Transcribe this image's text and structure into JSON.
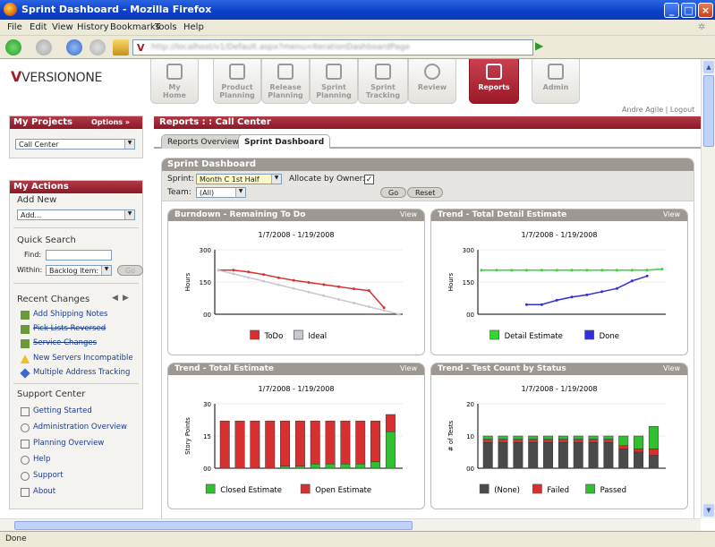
{
  "window": {
    "title": "Sprint Dashboard - Mozilla Firefox"
  },
  "menu": [
    "File",
    "Edit",
    "View",
    "History",
    "Bookmarks",
    "Tools",
    "Help"
  ],
  "browser": {
    "url": "http://localhost/v1/Default.aspx?menu=IterationDashboardPage",
    "status": "Done"
  },
  "app": {
    "logo": {
      "mark": "V",
      "name": "VERSIONONE"
    },
    "tabs": [
      {
        "label1": "My",
        "label2": "Home"
      },
      {
        "label1": "Product",
        "label2": "Planning"
      },
      {
        "label1": "Release",
        "label2": "Planning"
      },
      {
        "label1": "Sprint",
        "label2": "Planning"
      },
      {
        "label1": "Sprint",
        "label2": "Tracking"
      },
      {
        "label1": "Review",
        "label2": ""
      },
      {
        "label1": "Reports",
        "label2": ""
      },
      {
        "label1": "Admin",
        "label2": ""
      }
    ],
    "user": "Andre Agile",
    "logout": "Logout"
  },
  "sidebar": {
    "projects_title": "My Projects",
    "options": "Options »",
    "project": "Call Center",
    "actions_title": "My Actions",
    "add_new": "Add New",
    "add_select": "Add...",
    "quick_search": "Quick Search",
    "find_label": "Find:",
    "within_label": "Within:",
    "within_value": "Backlog Item:",
    "go": "Go",
    "recent_changes": "Recent Changes",
    "recent": [
      {
        "label": "Add Shipping Notes",
        "icon": "story-icon"
      },
      {
        "label": "Pick Lists Reversed",
        "icon": "story-icon",
        "struck": true
      },
      {
        "label": "Service Changes",
        "icon": "story-icon",
        "struck": true
      },
      {
        "label": "New Servers Incompatible",
        "icon": "warning-icon"
      },
      {
        "label": "Multiple Address Tracking",
        "icon": "diamond-icon"
      }
    ],
    "support_center": "Support Center",
    "support": [
      {
        "label": "Getting Started",
        "icon": "home-icon"
      },
      {
        "label": "Administration Overview",
        "icon": "wrench-icon"
      },
      {
        "label": "Planning Overview",
        "icon": "planning-icon"
      },
      {
        "label": "Help",
        "icon": "help-icon"
      },
      {
        "label": "Support",
        "icon": "support-icon"
      },
      {
        "label": "About",
        "icon": "about-icon"
      }
    ]
  },
  "main": {
    "breadcrumb": "Reports : : Call Center",
    "tabs": [
      "Reports Overview",
      "Sprint Dashboard"
    ],
    "dashboard_title": "Sprint Dashboard",
    "filters": {
      "sprint_label": "Sprint:",
      "sprint_value": "Month C 1st Half",
      "allocate_label": "Allocate by Owner:",
      "allocate_checked": "✓",
      "team_label": "Team:",
      "team_value": "(All)",
      "go": "Go",
      "reset": "Reset"
    },
    "view_label": "View"
  },
  "chart_data": [
    {
      "type": "line",
      "title": "Burndown - Remaining To Do",
      "subtitle": "1/7/2008 - 1/19/2008",
      "ylabel": "Hours",
      "ylim": [
        0,
        300
      ],
      "yticks": [
        "300",
        "150",
        "00"
      ],
      "x": [
        1,
        2,
        3,
        4,
        5,
        6,
        7,
        8,
        9,
        10,
        11,
        12,
        13
      ],
      "series": [
        {
          "name": "ToDo",
          "color": "#d83030",
          "values": [
            205,
            205,
            197,
            185,
            170,
            158,
            148,
            138,
            128,
            118,
            110,
            30,
            null
          ]
        },
        {
          "name": "Ideal",
          "color": "#c8c8d0",
          "values": [
            205,
            188,
            171,
            154,
            137,
            120,
            103,
            86,
            69,
            52,
            35,
            18,
            0
          ]
        }
      ]
    },
    {
      "type": "line",
      "title": "Trend - Total Detail Estimate",
      "subtitle": "1/7/2008 - 1/19/2008",
      "ylabel": "Hours",
      "ylim": [
        0,
        300
      ],
      "yticks": [
        "300",
        "150",
        "00"
      ],
      "x": [
        1,
        2,
        3,
        4,
        5,
        6,
        7,
        8,
        9,
        10,
        11,
        12,
        13
      ],
      "series": [
        {
          "name": "Detail Estimate",
          "color": "#30d830",
          "values": [
            205,
            205,
            205,
            205,
            205,
            205,
            205,
            205,
            205,
            205,
            205,
            205,
            210
          ]
        },
        {
          "name": "Done",
          "color": "#3030d8",
          "values": [
            null,
            null,
            null,
            45,
            45,
            65,
            80,
            90,
            105,
            120,
            155,
            178,
            null
          ]
        }
      ]
    },
    {
      "type": "bar",
      "title": "Trend - Total Estimate",
      "subtitle": "1/7/2008 - 1/19/2008",
      "ylabel": "Story Points",
      "ylim": [
        0,
        30
      ],
      "yticks": [
        "30",
        "15",
        "00"
      ],
      "categories": [
        "1",
        "2",
        "3",
        "4",
        "5",
        "6",
        "7",
        "8",
        "9",
        "10",
        "11",
        "12"
      ],
      "series": [
        {
          "name": "Closed Estimate",
          "color": "#30c030",
          "values": [
            0,
            0,
            0,
            0,
            1,
            1,
            2,
            2,
            2,
            2,
            3,
            17
          ]
        },
        {
          "name": "Open Estimate",
          "color": "#d83030",
          "values": [
            22,
            22,
            22,
            22,
            21,
            21,
            20,
            20,
            20,
            20,
            19,
            8
          ]
        }
      ]
    },
    {
      "type": "bar",
      "title": "Trend - Test Count by Status",
      "subtitle": "1/7/2008 - 1/19/2008",
      "ylabel": "# of Tests",
      "ylim": [
        0,
        20
      ],
      "yticks": [
        "20",
        "10",
        "00"
      ],
      "categories": [
        "1",
        "2",
        "3",
        "4",
        "5",
        "6",
        "7",
        "8",
        "9",
        "10",
        "11",
        "12"
      ],
      "series": [
        {
          "name": "(None)",
          "color": "#4a4a4a",
          "values": [
            8,
            8,
            8,
            8,
            8,
            8,
            8,
            8,
            8,
            6,
            5,
            4
          ]
        },
        {
          "name": "Failed",
          "color": "#d83030",
          "values": [
            1,
            1,
            1,
            1,
            1,
            1,
            1,
            1,
            1,
            1,
            1,
            2
          ]
        },
        {
          "name": "Passed",
          "color": "#30c030",
          "values": [
            1,
            1,
            1,
            1,
            1,
            1,
            1,
            1,
            1,
            3,
            4,
            7
          ]
        }
      ]
    }
  ]
}
